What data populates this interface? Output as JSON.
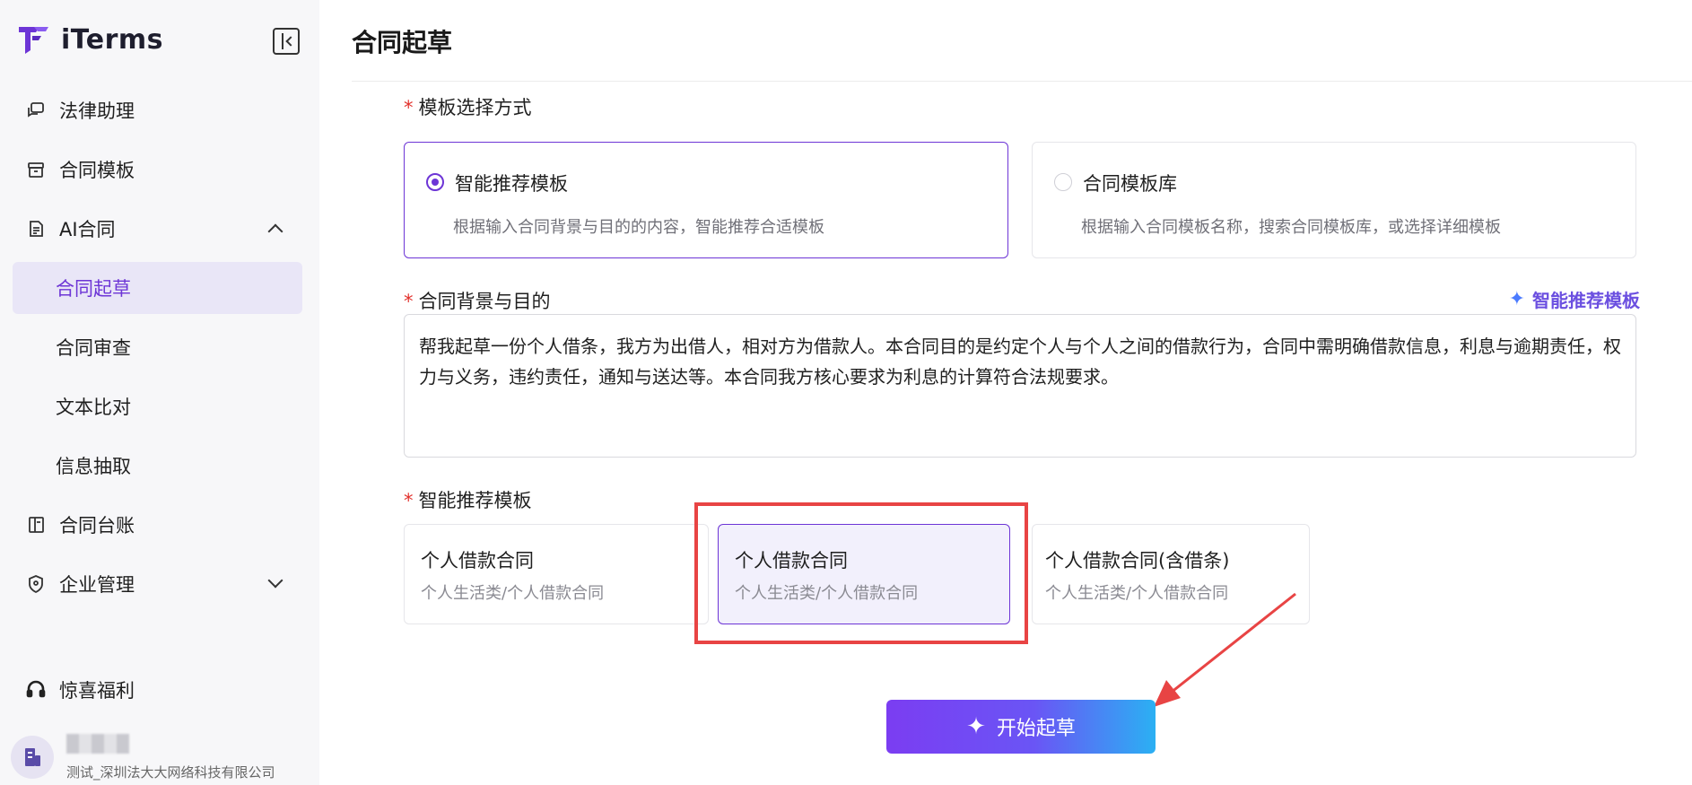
{
  "brand": {
    "name": "iTerms"
  },
  "sidebar": {
    "items": [
      {
        "label": "法律助理",
        "icon": "chat-icon"
      },
      {
        "label": "合同模板",
        "icon": "box-icon"
      },
      {
        "label": "AI合同",
        "icon": "document-icon",
        "expanded": true,
        "children": [
          {
            "label": "合同起草",
            "active": true
          },
          {
            "label": "合同审查"
          },
          {
            "label": "文本比对"
          },
          {
            "label": "信息抽取"
          }
        ]
      },
      {
        "label": "合同台账",
        "icon": "book-icon"
      },
      {
        "label": "企业管理",
        "icon": "shield-icon",
        "expanded": false
      }
    ],
    "bonus": {
      "label": "惊喜福利",
      "icon": "headset-icon"
    },
    "user": {
      "org": "测试_深圳法大大网络科技有限公司"
    }
  },
  "main": {
    "title": "合同起草",
    "template_mode": {
      "label": "模板选择方式",
      "options": [
        {
          "title": "智能推荐模板",
          "desc": "根据输入合同背景与目的的内容，智能推荐合适模板",
          "selected": true
        },
        {
          "title": "合同模板库",
          "desc": "根据输入合同模板名称，搜索合同模板库，或选择详细模板",
          "selected": false
        }
      ]
    },
    "background": {
      "label": "合同背景与目的",
      "smart_link": "智能推荐模板",
      "value": "帮我起草一份个人借条，我方为出借人，相对方为借款人。本合同目的是约定个人与个人之间的借款行为，合同中需明确借款信息，利息与逾期责任，权力与义务，违约责任，通知与送达等。本合同我方核心要求为利息的计算符合法规要求。"
    },
    "recommend": {
      "label": "智能推荐模板",
      "templates": [
        {
          "name": "个人借款合同",
          "category": "个人生活类/个人借款合同",
          "selected": false
        },
        {
          "name": "个人借款合同",
          "category": "个人生活类/个人借款合同",
          "selected": true
        },
        {
          "name": "个人借款合同(含借条)",
          "category": "个人生活类/个人借款合同",
          "selected": false
        }
      ]
    },
    "start_button": "开始起草"
  },
  "colors": {
    "accent": "#6d35d6",
    "required": "#e2312c",
    "highlight": "#e84444"
  }
}
